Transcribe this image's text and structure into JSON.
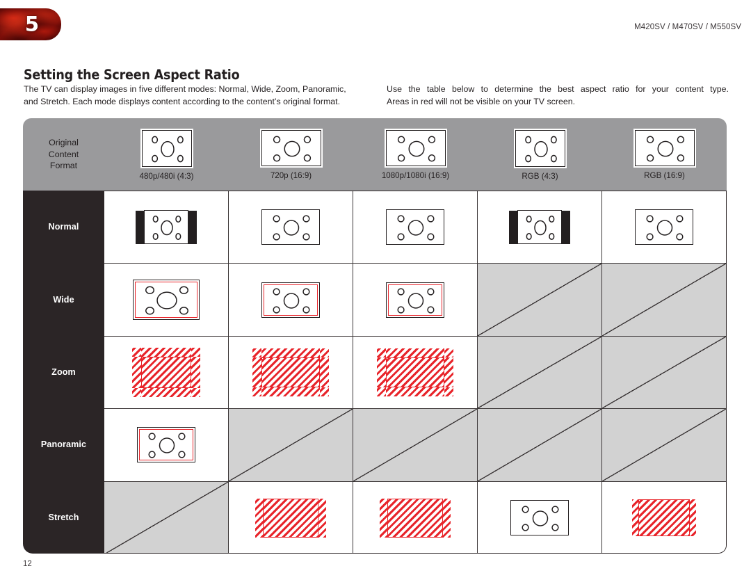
{
  "header": {
    "chapter_number": "5",
    "models": "M420SV / M470SV / M550SV"
  },
  "page_title": "Setting the Screen Aspect Ratio",
  "intro": {
    "left_line1": "The TV can display images in five different modes: Normal, Wide, Zoom, Panoramic,",
    "left_line2": "and Stretch. Each mode displays content according to the content’s original format.",
    "right_line1": "Use the table below to determine the best aspect ratio for your content type.",
    "right_line2": "Areas in red will not be visible on your TV screen."
  },
  "table": {
    "corner_label_lines": [
      "Original",
      "Content",
      "Format"
    ],
    "columns": [
      {
        "caption": "480p/480i (4:3)",
        "shape": "4:3"
      },
      {
        "caption": "720p (16:9)",
        "shape": "16:9"
      },
      {
        "caption": "1080p/1080i (16:9)",
        "shape": "16:9"
      },
      {
        "caption": "RGB (4:3)",
        "shape": "4:3"
      },
      {
        "caption": "RGB (16:9)",
        "shape": "16:9"
      }
    ],
    "rows": [
      {
        "label": "Normal",
        "cells": [
          {
            "state": "shown",
            "render": "pillarbox"
          },
          {
            "state": "shown",
            "render": "plain-wide"
          },
          {
            "state": "shown",
            "render": "plain-wide"
          },
          {
            "state": "shown",
            "render": "pillarbox"
          },
          {
            "state": "shown",
            "render": "plain-wide"
          }
        ]
      },
      {
        "label": "Wide",
        "cells": [
          {
            "state": "shown",
            "render": "thin-red-inset-tall"
          },
          {
            "state": "shown",
            "render": "thin-red-inset-wide"
          },
          {
            "state": "shown",
            "render": "thin-red-inset-wide"
          },
          {
            "state": "disabled",
            "render": "diagonal"
          },
          {
            "state": "disabled",
            "render": "diagonal"
          }
        ]
      },
      {
        "label": "Zoom",
        "cells": [
          {
            "state": "shown",
            "render": "thick-hatch-tall"
          },
          {
            "state": "shown",
            "render": "thick-hatch-wide"
          },
          {
            "state": "shown",
            "render": "thick-hatch-wide"
          },
          {
            "state": "disabled",
            "render": "diagonal"
          },
          {
            "state": "disabled",
            "render": "diagonal"
          }
        ]
      },
      {
        "label": "Panoramic",
        "cells": [
          {
            "state": "shown",
            "render": "thin-red-inset-wide"
          },
          {
            "state": "disabled",
            "render": "diagonal"
          },
          {
            "state": "disabled",
            "render": "diagonal"
          },
          {
            "state": "disabled",
            "render": "diagonal"
          },
          {
            "state": "disabled",
            "render": "diagonal"
          }
        ]
      },
      {
        "label": "Stretch",
        "cells": [
          {
            "state": "disabled",
            "render": "diagonal"
          },
          {
            "state": "shown",
            "render": "side-hatch-wide"
          },
          {
            "state": "shown",
            "render": "side-hatch-wide"
          },
          {
            "state": "shown",
            "render": "plain-wide"
          },
          {
            "state": "shown",
            "render": "side-hatch-small"
          }
        ]
      }
    ]
  },
  "page_number": "12",
  "colors": {
    "red_overscan": "#e8242a",
    "header_gray": "#9a9a9c",
    "label_black": "#2b2526",
    "disabled_gray": "#d2d2d2"
  }
}
